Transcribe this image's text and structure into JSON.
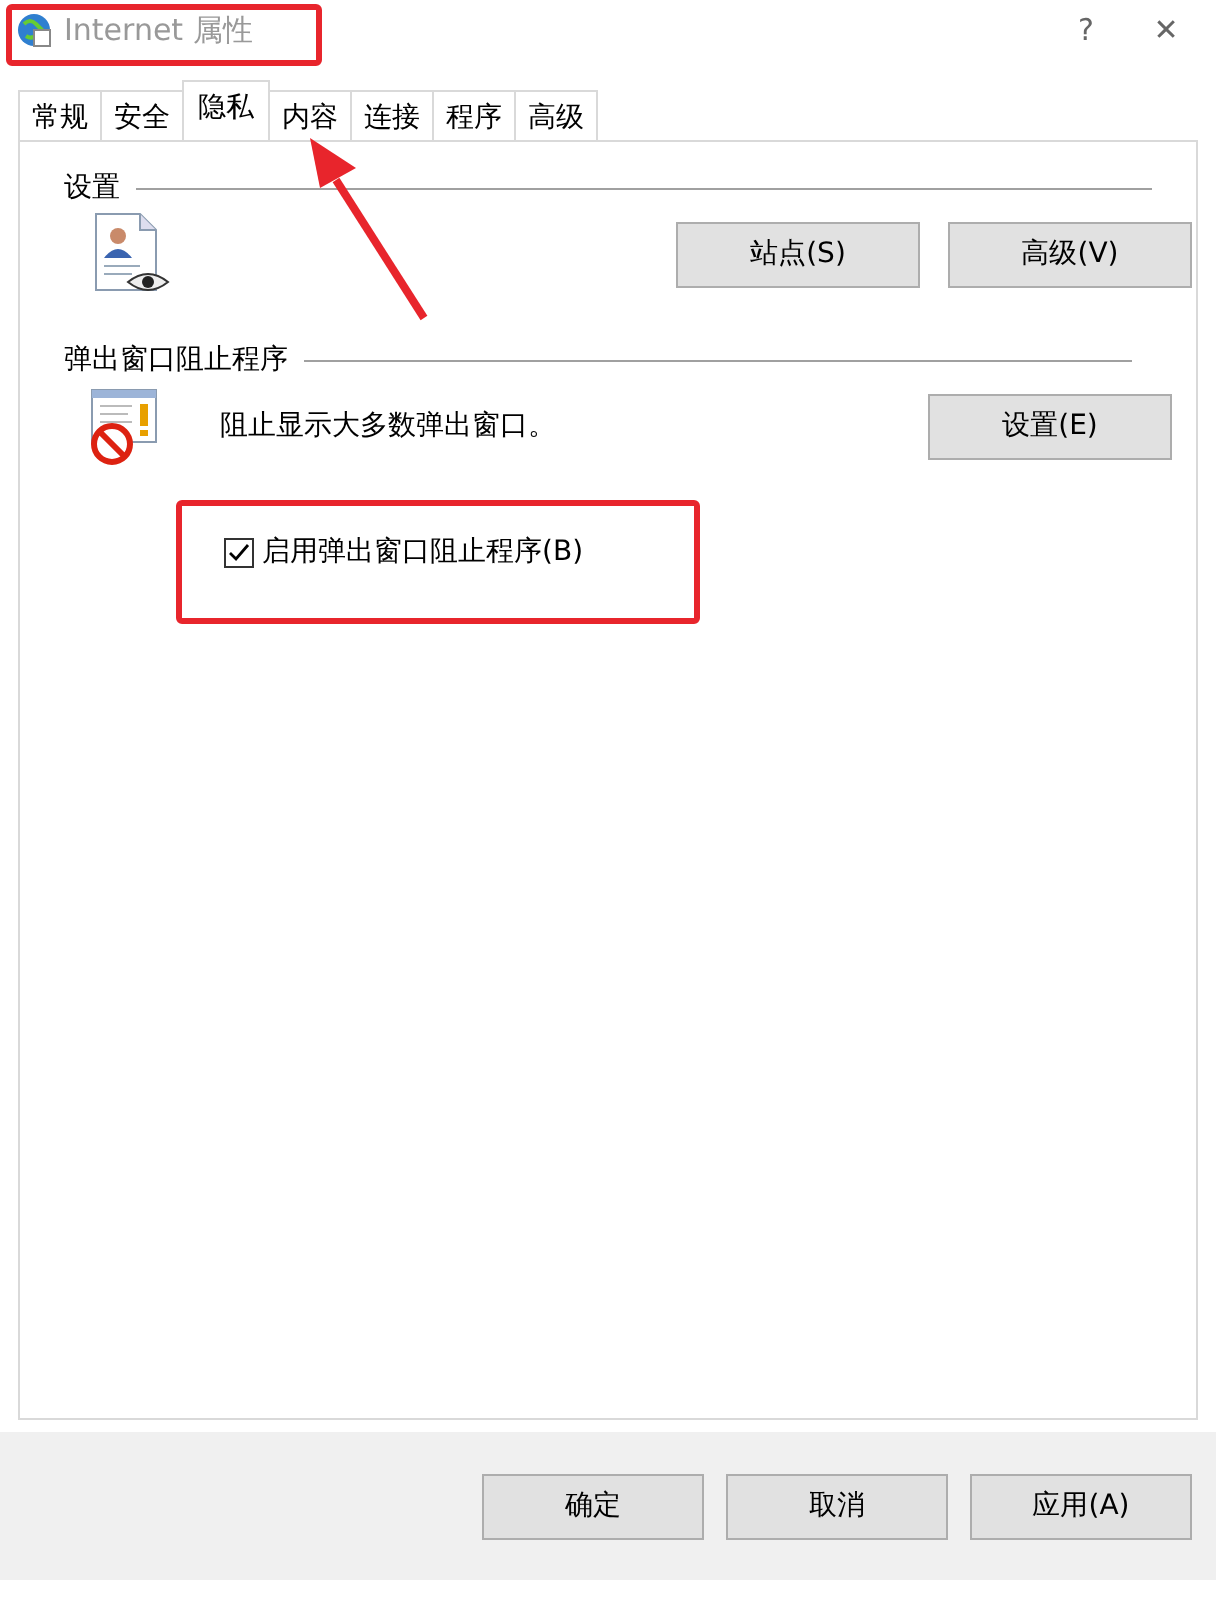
{
  "window": {
    "title": "Internet 属性",
    "help": "?",
    "close": "✕"
  },
  "tabs": [
    {
      "label": "常规",
      "selected": false
    },
    {
      "label": "安全",
      "selected": false
    },
    {
      "label": "隐私",
      "selected": true
    },
    {
      "label": "内容",
      "selected": false
    },
    {
      "label": "连接",
      "selected": false
    },
    {
      "label": "程序",
      "selected": false
    },
    {
      "label": "高级",
      "selected": false
    }
  ],
  "settings_group": {
    "title": "设置",
    "buttons": [
      "站点(S)",
      "高级(V)"
    ]
  },
  "popup_group": {
    "title": "弹出窗口阻止程序",
    "description": "阻止显示大多数弹出窗口。",
    "button": "设置(E)",
    "checkbox": {
      "label": "启用弹出窗口阻止程序(B)",
      "checked": true
    }
  },
  "buttons": [
    "确定",
    "取消",
    "应用(A)"
  ],
  "annotations": [
    {
      "kind": "frame"
    },
    {
      "kind": "arrow"
    },
    {
      "kind": "frame"
    }
  ]
}
